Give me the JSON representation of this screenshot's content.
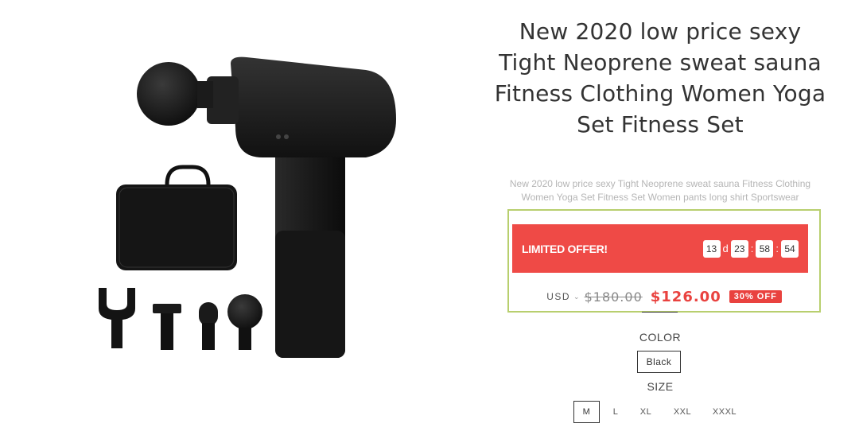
{
  "product": {
    "title": "New 2020 low price sexy Tight Neoprene sweat sauna Fitness Clothing Women Yoga Set Fitness Set",
    "subtitle": "New 2020 low price sexy Tight Neoprene sweat sauna Fitness Clothing Women Yoga Set Fitness Set Women pants long shirt Sportswear"
  },
  "offer": {
    "label": "LIMITED OFFER!",
    "days": "13",
    "days_unit": "d",
    "hours": "23",
    "minutes": "58",
    "seconds": "54",
    "separator": ":"
  },
  "price": {
    "currency": "USD",
    "currency_caret": "⌄",
    "old": "$180.00",
    "new": "$126.00",
    "discount": "30% OFF"
  },
  "color": {
    "label": "COLOR",
    "selected": "Black"
  },
  "size": {
    "label": "SIZE",
    "options": [
      "M",
      "L",
      "XL",
      "XXL",
      "XXXL"
    ],
    "selected": "M"
  },
  "colors": {
    "offer_red": "#ef4a46",
    "price_red": "#e9423f",
    "box_border": "#b8cf6e"
  }
}
